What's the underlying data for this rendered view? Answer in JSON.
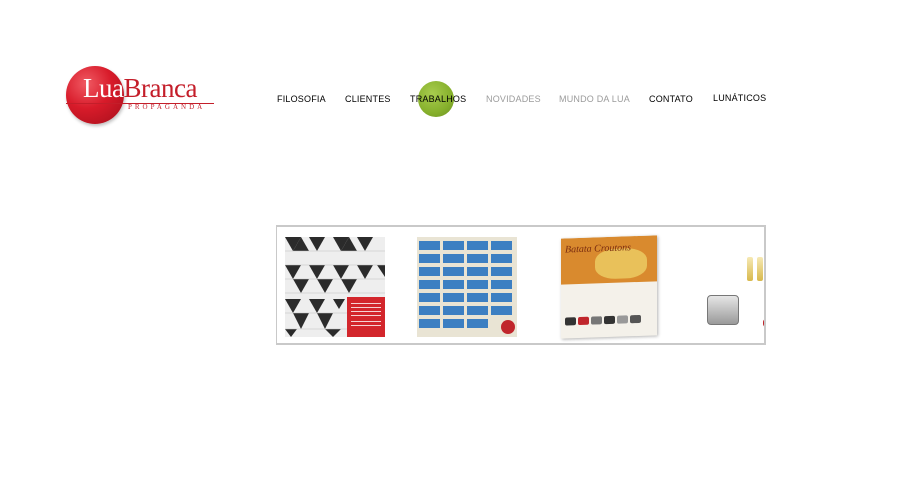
{
  "brand": {
    "logo_main_1": "Lua",
    "logo_main_2": "Branca",
    "logo_sub": "PROPAGANDA",
    "logo_color": "#c41e2a"
  },
  "nav": {
    "items": [
      {
        "label": "FILOSOFIA"
      },
      {
        "label": "CLIENTES"
      },
      {
        "label": "TRABALHOS",
        "active": true
      },
      {
        "label": "NOVIDADES",
        "muted": true
      },
      {
        "label": "MUNDO DA LUA",
        "muted": true
      },
      {
        "label": "CONTATO"
      },
      {
        "label": "LUNÁTICOS"
      }
    ],
    "active_color": "#86b02c",
    "muted_color": "#9b9b9b"
  },
  "gallery": {
    "thumbnails": [
      {
        "icon": "pavement-pattern-image"
      },
      {
        "icon": "blue-grid-poster-image"
      },
      {
        "title": "Batata Croutons",
        "icon": "croutons-ad-image"
      },
      {
        "icon": "toaster-image"
      }
    ]
  }
}
